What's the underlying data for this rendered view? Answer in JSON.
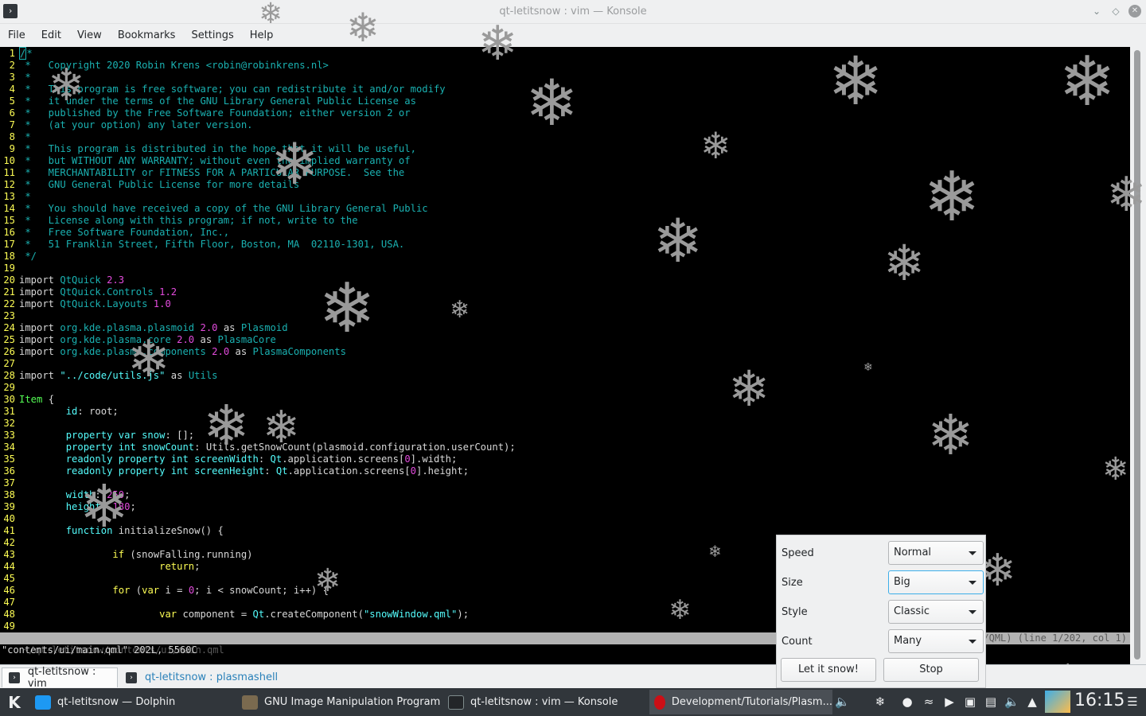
{
  "window": {
    "title": "qt-letitsnow : vim — Konsole",
    "icon_glyph": "›"
  },
  "menu": [
    "File",
    "Edit",
    "View",
    "Bookmarks",
    "Settings",
    "Help"
  ],
  "editor": {
    "lines": [
      {
        "n": "1",
        "segs": [
          [
            "cursor",
            "/"
          ],
          [
            "cm",
            "*"
          ]
        ]
      },
      {
        "n": "2",
        "segs": [
          [
            "cm",
            " *   Copyright 2020 Robin Krens <robin@robinkrens.nl>"
          ]
        ]
      },
      {
        "n": "3",
        "segs": [
          [
            "cm",
            " *"
          ]
        ]
      },
      {
        "n": "4",
        "segs": [
          [
            "cm",
            " *   This program is free software; you can redistribute it and/or modify"
          ]
        ]
      },
      {
        "n": "5",
        "segs": [
          [
            "cm",
            " *   it under the terms of the GNU Library General Public License as"
          ]
        ]
      },
      {
        "n": "6",
        "segs": [
          [
            "cm",
            " *   published by the Free Software Foundation; either version 2 or"
          ]
        ]
      },
      {
        "n": "7",
        "segs": [
          [
            "cm",
            " *   (at your option) any later version."
          ]
        ]
      },
      {
        "n": "8",
        "segs": [
          [
            "cm",
            " *"
          ]
        ]
      },
      {
        "n": "9",
        "segs": [
          [
            "cm",
            " *   This program is distributed in the hope that it will be useful,"
          ]
        ]
      },
      {
        "n": "10",
        "segs": [
          [
            "cm",
            " *   but WITHOUT ANY WARRANTY; without even the implied warranty of"
          ]
        ]
      },
      {
        "n": "11",
        "segs": [
          [
            "cm",
            " *   MERCHANTABILITY or FITNESS FOR A PARTICULAR PURPOSE.  See the"
          ]
        ]
      },
      {
        "n": "12",
        "segs": [
          [
            "cm",
            " *   GNU General Public License for more details"
          ]
        ]
      },
      {
        "n": "13",
        "segs": [
          [
            "cm",
            " *"
          ]
        ]
      },
      {
        "n": "14",
        "segs": [
          [
            "cm",
            " *   You should have received a copy of the GNU Library General Public"
          ]
        ]
      },
      {
        "n": "15",
        "segs": [
          [
            "cm",
            " *   License along with this program; if not, write to the"
          ]
        ]
      },
      {
        "n": "16",
        "segs": [
          [
            "cm",
            " *   Free Software Foundation, Inc.,"
          ]
        ]
      },
      {
        "n": "17",
        "segs": [
          [
            "cm",
            " *   51 Franklin Street, Fifth Floor, Boston, MA  02110-1301, USA."
          ]
        ]
      },
      {
        "n": "18",
        "segs": [
          [
            "cm",
            " */"
          ]
        ]
      },
      {
        "n": "19",
        "segs": []
      },
      {
        "n": "20",
        "segs": [
          [
            "tx",
            "import "
          ],
          [
            "kw2",
            "QtQuick "
          ],
          [
            "num",
            "2.3"
          ]
        ]
      },
      {
        "n": "21",
        "segs": [
          [
            "tx",
            "import "
          ],
          [
            "kw2",
            "QtQuick.Controls "
          ],
          [
            "num",
            "1.2"
          ]
        ]
      },
      {
        "n": "22",
        "segs": [
          [
            "tx",
            "import "
          ],
          [
            "kw2",
            "QtQuick.Layouts "
          ],
          [
            "num",
            "1.0"
          ]
        ]
      },
      {
        "n": "23",
        "segs": []
      },
      {
        "n": "24",
        "segs": [
          [
            "tx",
            "import "
          ],
          [
            "kw2",
            "org.kde.plasma.plasmoid "
          ],
          [
            "num",
            "2.0"
          ],
          [
            "tx",
            " as "
          ],
          [
            "kw2",
            "Plasmoid"
          ]
        ]
      },
      {
        "n": "25",
        "segs": [
          [
            "tx",
            "import "
          ],
          [
            "kw2",
            "org.kde.plasma.core "
          ],
          [
            "num",
            "2.0"
          ],
          [
            "tx",
            " as "
          ],
          [
            "kw2",
            "PlasmaCore"
          ]
        ]
      },
      {
        "n": "26",
        "segs": [
          [
            "tx",
            "import "
          ],
          [
            "kw2",
            "org.kde.plasma.components "
          ],
          [
            "num",
            "2.0"
          ],
          [
            "tx",
            " as "
          ],
          [
            "kw2",
            "PlasmaComponents"
          ]
        ]
      },
      {
        "n": "27",
        "segs": []
      },
      {
        "n": "28",
        "segs": [
          [
            "tx",
            "import "
          ],
          [
            "str",
            "\"../code/utils.js\""
          ],
          [
            "tx",
            " as "
          ],
          [
            "kw2",
            "Utils"
          ]
        ]
      },
      {
        "n": "29",
        "segs": []
      },
      {
        "n": "30",
        "segs": [
          [
            "ty",
            "Item"
          ],
          [
            "tx",
            " {"
          ]
        ]
      },
      {
        "n": "31",
        "segs": [
          [
            "tx",
            "        "
          ],
          [
            "str",
            "id"
          ],
          [
            "tx",
            ": root;"
          ]
        ]
      },
      {
        "n": "32",
        "segs": []
      },
      {
        "n": "33",
        "segs": [
          [
            "tx",
            "        "
          ],
          [
            "str",
            "property var snow"
          ],
          [
            "tx",
            ": [];"
          ]
        ]
      },
      {
        "n": "34",
        "segs": [
          [
            "tx",
            "        "
          ],
          [
            "str",
            "property int snowCount"
          ],
          [
            "tx",
            ": Utils.getSnowCount(plasmoid.configuration.userCount);"
          ]
        ]
      },
      {
        "n": "35",
        "segs": [
          [
            "tx",
            "        "
          ],
          [
            "str",
            "readonly property int screenWidth"
          ],
          [
            "tx",
            ": "
          ],
          [
            "str",
            "Qt"
          ],
          [
            "tx",
            ".application.screens["
          ],
          [
            "num",
            "0"
          ],
          [
            "tx",
            "].width;"
          ]
        ]
      },
      {
        "n": "36",
        "segs": [
          [
            "tx",
            "        "
          ],
          [
            "str",
            "readonly property int screenHeight"
          ],
          [
            "tx",
            ": "
          ],
          [
            "str",
            "Qt"
          ],
          [
            "tx",
            ".application.screens["
          ],
          [
            "num",
            "0"
          ],
          [
            "tx",
            "].height;"
          ]
        ]
      },
      {
        "n": "37",
        "segs": []
      },
      {
        "n": "38",
        "segs": [
          [
            "tx",
            "        "
          ],
          [
            "str",
            "width"
          ],
          [
            "tx",
            ": "
          ],
          [
            "num",
            "250"
          ],
          [
            "tx",
            ";"
          ]
        ]
      },
      {
        "n": "39",
        "segs": [
          [
            "tx",
            "        "
          ],
          [
            "str",
            "height"
          ],
          [
            "tx",
            ": "
          ],
          [
            "num",
            "180"
          ],
          [
            "tx",
            ";"
          ]
        ]
      },
      {
        "n": "40",
        "segs": []
      },
      {
        "n": "41",
        "segs": [
          [
            "tx",
            "        "
          ],
          [
            "str",
            "function"
          ],
          [
            "tx",
            " initializeSnow() {"
          ]
        ]
      },
      {
        "n": "42",
        "segs": []
      },
      {
        "n": "43",
        "segs": [
          [
            "tx",
            "                "
          ],
          [
            "kw",
            "if"
          ],
          [
            "tx",
            " (snowFalling.running)"
          ]
        ]
      },
      {
        "n": "44",
        "segs": [
          [
            "tx",
            "                        "
          ],
          [
            "kw",
            "return"
          ],
          [
            "tx",
            ";"
          ]
        ]
      },
      {
        "n": "45",
        "segs": []
      },
      {
        "n": "46",
        "segs": [
          [
            "tx",
            "                "
          ],
          [
            "kw",
            "for"
          ],
          [
            "tx",
            " ("
          ],
          [
            "kw",
            "var"
          ],
          [
            "tx",
            " i = "
          ],
          [
            "num",
            "0"
          ],
          [
            "tx",
            "; i < snowCount; i++) {"
          ]
        ]
      },
      {
        "n": "47",
        "segs": []
      },
      {
        "n": "48",
        "segs": [
          [
            "tx",
            "                        "
          ],
          [
            "kw",
            "var"
          ],
          [
            "tx",
            " component = "
          ],
          [
            "str",
            "Qt"
          ],
          [
            "tx",
            ".createComponent("
          ],
          [
            "str",
            "\"snowWindow.qml\""
          ],
          [
            "tx",
            ");"
          ]
        ]
      },
      {
        "n": "49",
        "segs": []
      }
    ],
    "statusline_left": "~/qt-letitsnow/contents/ui/main.qml",
    "statusline_right": "/QML) (line 1/202, col 1)",
    "cmdline": "\"contents/ui/main.qml\" 202L, 5560C"
  },
  "tabs": [
    {
      "label": "qt-letitsnow : vim",
      "active": true
    },
    {
      "label": "qt-letitsnow : plasmashell",
      "active": false
    }
  ],
  "taskbar": {
    "tasks": [
      {
        "label": "qt-letitsnow — Dolphin",
        "color": "#1d99f3"
      },
      {
        "label": "GNU Image Manipulation Program",
        "color": "#7a6a4f"
      },
      {
        "label": "qt-letitsnow : vim — Konsole",
        "color": "#31363b"
      },
      {
        "label": "Development/Tutorials/Plasm...",
        "color": "#cc0f16"
      }
    ],
    "clock": "16:15"
  },
  "applet": {
    "rows": [
      {
        "label": "Speed",
        "value": "Normal"
      },
      {
        "label": "Size",
        "value": "Big"
      },
      {
        "label": "Style",
        "value": "Classic"
      },
      {
        "label": "Count",
        "value": "Many"
      }
    ],
    "start_label": "Let it snow!",
    "stop_label": "Stop"
  }
}
